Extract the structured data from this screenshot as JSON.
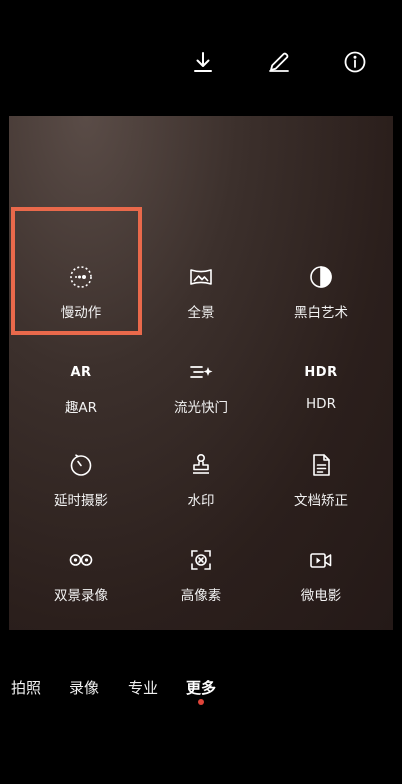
{
  "toolbar": {
    "icons": [
      "download-icon",
      "edit-icon",
      "info-icon"
    ]
  },
  "modes_grid": [
    {
      "label": "慢动作",
      "icon": "slow-motion-icon",
      "selected": true
    },
    {
      "label": "全景",
      "icon": "panorama-icon"
    },
    {
      "label": "黑白艺术",
      "icon": "monochrome-icon"
    },
    {
      "label": "趣AR",
      "icon": "ar-icon",
      "icon_text": "AR"
    },
    {
      "label": "流光快门",
      "icon": "light-painting-icon"
    },
    {
      "label": "HDR",
      "icon": "hdr-icon",
      "icon_text": "HDR"
    },
    {
      "label": "延时摄影",
      "icon": "time-lapse-icon"
    },
    {
      "label": "水印",
      "icon": "watermark-icon"
    },
    {
      "label": "文档矫正",
      "icon": "document-correction-icon"
    },
    {
      "label": "双景录像",
      "icon": "dual-view-icon"
    },
    {
      "label": "高像素",
      "icon": "high-resolution-icon"
    },
    {
      "label": "微电影",
      "icon": "micro-movie-icon"
    }
  ],
  "bottom_modes": [
    {
      "label": "拍照"
    },
    {
      "label": "录像"
    },
    {
      "label": "专业"
    },
    {
      "label": "更多",
      "active": true
    }
  ],
  "colors": {
    "highlight": "#e9694b",
    "active_dot": "#e0453a"
  }
}
